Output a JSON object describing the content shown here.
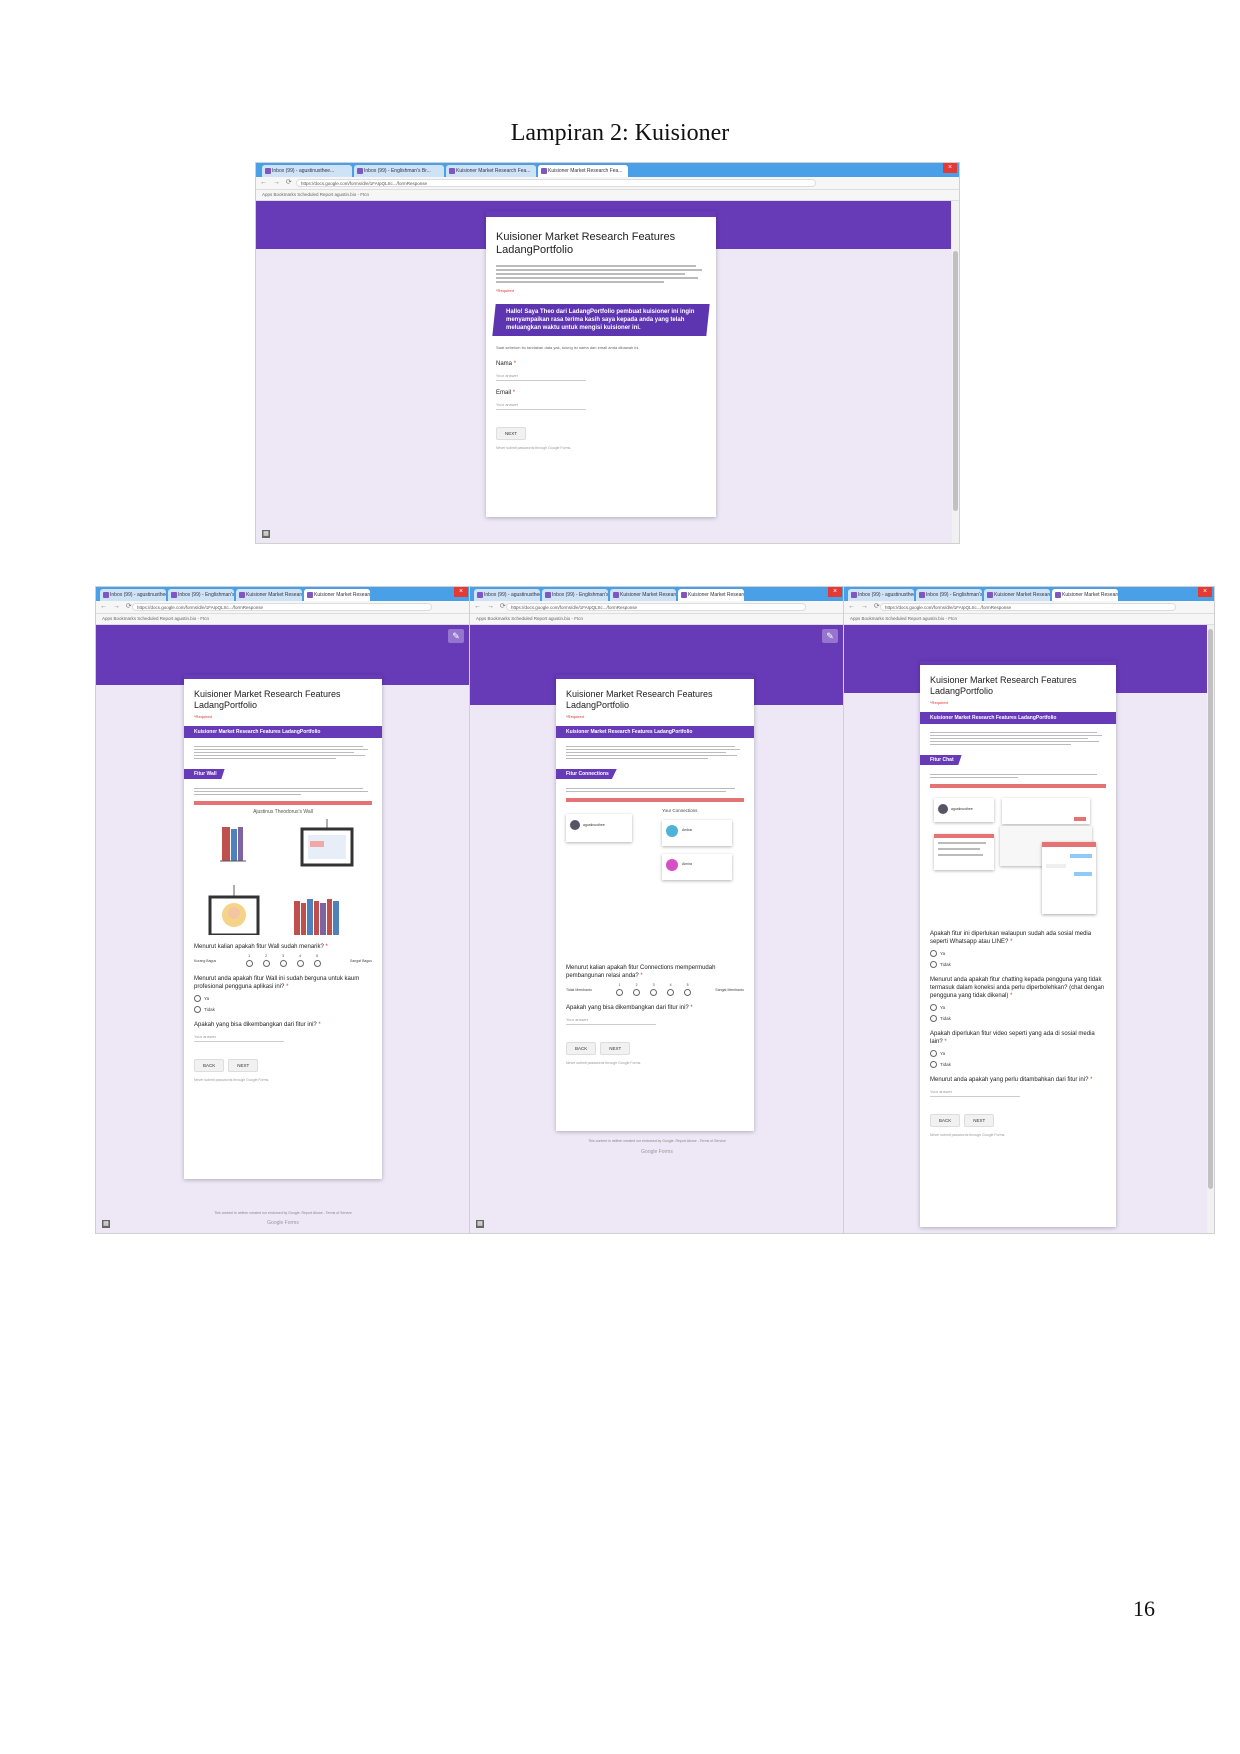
{
  "caption": "Lampiran 2: Kuisioner",
  "page_number": "16",
  "form": {
    "title": "Kuisioner Market Research Features LadangPortfolio",
    "required_note": "*Required",
    "section_title": "Kuisioner Market Research Features LadangPortfolio",
    "banner": "Hallo! Saya Theo dari LadangPortfolio pembuat kuisioner ini ingin menyampaikan rasa terima kasih saya kepada anda yang telah meluangkan waktu untuk mengisi kuisioner ini.",
    "intro": "Saat sebelum itu tandakan data yak, tulung isi nama dan email anda dibawah ini.",
    "nama_label": "Nama",
    "email_label": "Email",
    "answer_placeholder": "Your answer",
    "next": "NEXT",
    "back": "BACK",
    "foot_note": "Never submit passwords through Google Forms.",
    "footer": "This content is neither created nor endorsed by Google. Report Abuse - Terms of Service",
    "google_forms": "Google Forms"
  },
  "wall": {
    "tag": "Fitur Wall",
    "illustration_caption": "Ajustinus Theodorus's Wall",
    "q1": "Menurut kalian apakah fitur Wall sudah menarik?",
    "scale_low": "Kurang Bagus",
    "scale_high": "Sangat Bagus",
    "scale": [
      "1",
      "2",
      "3",
      "4",
      "5"
    ],
    "q2": "Menurut anda apakah fitur Wall ini sudah berguna untuk kaum profesional pengguna aplikasi ini?",
    "opt_yes": "Ya",
    "opt_no": "Tidak",
    "q3": "Apakah yang bisa dikembangkan dari fitur ini?"
  },
  "connections": {
    "tag": "Fitur Connections",
    "profile": "agustinusthee",
    "your_connections": "Your Connections",
    "conn1": "Ambar",
    "conn2": "Almira",
    "q1": "Menurut kalian apakah fitur Connections mempermudah pembangunan relasi anda?",
    "scale_low": "Tidak Membantu",
    "scale_high": "Sangat Membantu",
    "scale": [
      "1",
      "2",
      "3",
      "4",
      "5"
    ],
    "q2": "Apakah yang bisa dikembangkan dari fitur ini?"
  },
  "chat": {
    "tag": "Fitur Chat",
    "profile": "agustinusthee",
    "q1": "Apakah fitur ini diperlukan walaupun sudah ada sosial media seperti Whatsapp atau LINE?",
    "q2": "Menurut anda apakah fitur chatting kepada pengguna yang tidak termasuk dalam koneksi anda perlu diperbolehkan? (chat dengan pengguna yang tidak dikenal)",
    "q3": "Apakah diperlukan fitur video seperti yang ada di sosial media lain?",
    "q4": "Menurut anda apakah yang perlu ditambahkan dari fitur ini?",
    "opt_yes": "Ya",
    "opt_no": "Tidak"
  },
  "browser": {
    "tabs": [
      "Inbox (99) - agustinusthee...",
      "Inbox (99) - Englishman's Br...",
      "Kuisioner Market Research Fea...",
      "Kuisioner Market Research Fea..."
    ],
    "url": "https://docs.google.com/forms/d/e/1FAIpQLSc.../formResponse",
    "bookmarks": "Apps   Bookmarks   Scheduled Report   agustin.bio - Ftcn"
  },
  "colors": {
    "accent": "#673ab7",
    "background": "#ede7f6",
    "chrome_tab": "#4aa0e6"
  }
}
